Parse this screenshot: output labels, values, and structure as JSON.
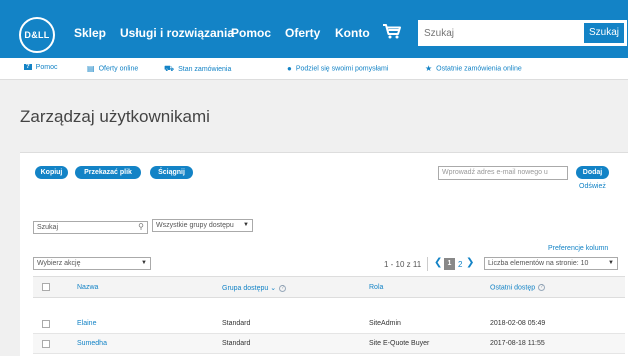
{
  "header": {
    "logo_text": "D&LL",
    "nav": [
      "Sklep",
      "Usługi i rozwiązania",
      "Pomoc",
      "Oferty",
      "Konto"
    ],
    "search_placeholder": "Szukaj",
    "search_button": "Szukaj"
  },
  "subnav": [
    {
      "icon": "help-icon",
      "label": "Pomoc"
    },
    {
      "icon": "document-icon",
      "label": "Oferty online"
    },
    {
      "icon": "truck-icon",
      "label": "Stan zamówienia"
    },
    {
      "icon": "lightbulb-icon",
      "label": "Podziel się swoimi pomysłami"
    },
    {
      "icon": "star-icon",
      "label": "Ostatnie zamówienia online"
    }
  ],
  "page": {
    "title": "Zarządzaj użytkownikami"
  },
  "toolbar": {
    "copy_label": "Kopiuj",
    "upload_label": "Przekazać plik",
    "download_label": "Ściągnij",
    "email_placeholder": "Wprowadź adres e-mail nowego u",
    "add_label": "Dodaj",
    "refresh_label": "Odśwież"
  },
  "filters": {
    "search_value": "Szukaj",
    "group_select": "Wszystkie grupy dostępu",
    "column_prefs": "Preferencje kolumn",
    "action_select": "Wybierz akcję"
  },
  "pagination": {
    "range": "1 - 10 z 11",
    "current_page": "1",
    "next_page": "2",
    "per_page_label": "Liczba elementów na stronie:",
    "per_page_value": "10"
  },
  "table": {
    "columns": [
      "Nazwa",
      "Grupa dostępu",
      "Rola",
      "Ostatni dostęp"
    ],
    "rows": [
      {
        "name": "Elaine",
        "group": "Standard",
        "role": "SiteAdmin",
        "last_access": "2018-02-08 05:49"
      },
      {
        "name": "Sumedha",
        "group": "Standard",
        "role": "Site E-Quote Buyer",
        "last_access": "2017-08-18 11:55"
      }
    ]
  },
  "colors": {
    "brand": "#1383c6",
    "background": "#f0f0f0"
  }
}
